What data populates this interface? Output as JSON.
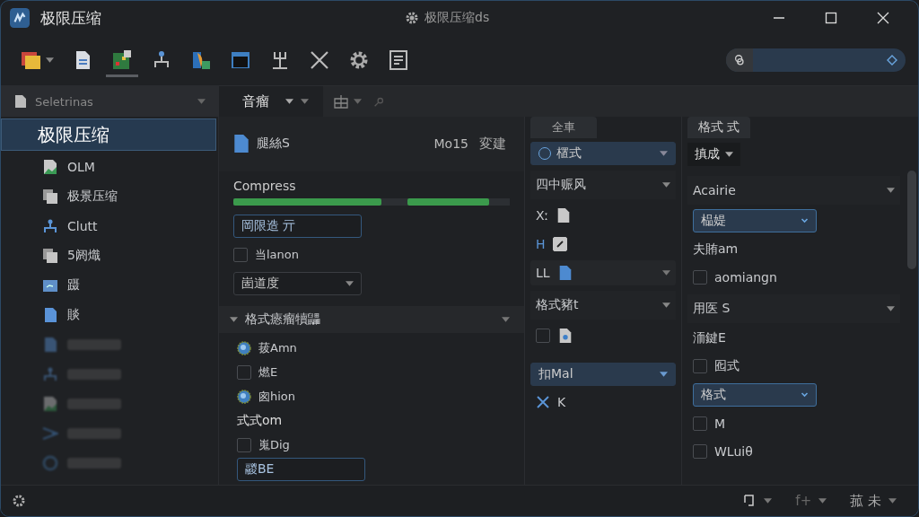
{
  "window": {
    "title": "极限压缩",
    "center_title": "极限压缩ds"
  },
  "toolbar": {
    "tools": [
      {
        "kind": "folder",
        "selected": false
      },
      {
        "kind": "doc",
        "selected": false
      },
      {
        "kind": "grid",
        "selected": true
      },
      {
        "kind": "network",
        "selected": false
      },
      {
        "kind": "box",
        "selected": false
      },
      {
        "kind": "monitor",
        "selected": false
      },
      {
        "kind": "fork",
        "selected": false
      },
      {
        "kind": "scissors",
        "selected": false
      },
      {
        "kind": "gear",
        "selected": false
      },
      {
        "kind": "list",
        "selected": false
      }
    ]
  },
  "sidebar": {
    "header": "Seletrinas",
    "items": [
      {
        "label": "极限压缩",
        "kind": "plain",
        "selected": true
      },
      {
        "label": "OLM",
        "kind": "image",
        "selected": false
      },
      {
        "label": "极景压缩",
        "kind": "copy",
        "selected": false
      },
      {
        "label": "Clutt",
        "kind": "network",
        "selected": false
      },
      {
        "label": "5阏熾",
        "kind": "copy",
        "selected": false
      },
      {
        "label": "蹑",
        "kind": "folder",
        "selected": false
      },
      {
        "label": "賧",
        "kind": "doc",
        "selected": false
      },
      {
        "kind": "doc",
        "selected": false
      },
      {
        "kind": "network",
        "selected": false
      },
      {
        "kind": "image",
        "selected": false
      },
      {
        "kind": "scissors",
        "selected": false
      },
      {
        "kind": "ring",
        "selected": false
      }
    ]
  },
  "content_tab": {
    "label": "音瘤"
  },
  "panel_main": {
    "file_name": "腿絲S",
    "meta": "Mo15",
    "action": "変建",
    "progress_label": "Compress",
    "progress": [
      {
        "level": 0.85
      },
      {
        "level": 0.8
      }
    ],
    "name_field": {
      "value": "岡限造 亓"
    },
    "option": {
      "label": "当lanon",
      "checked": false
    },
    "select": {
      "value": "崮道度"
    },
    "section": {
      "title": "格式瘱瘤犢鼺",
      "expanded": true,
      "items": [
        {
          "kind": "globe",
          "label": "菝Amn"
        },
        {
          "kind": "checkbox",
          "label": "燃E",
          "checked": false
        },
        {
          "kind": "globe",
          "label": "囪hion"
        },
        {
          "kind": "text",
          "label": "式式om"
        },
        {
          "kind": "checkbox",
          "label": "嵬Dig",
          "checked": false
        },
        {
          "kind": "field",
          "label": "鬷BE"
        }
      ]
    }
  },
  "panel_mid": {
    "tab": "全車",
    "select": {
      "value": "㯰式"
    },
    "groups": [
      {
        "title": "四中赈风",
        "rows": [
          {
            "kind": "file",
            "label": "Xː"
          },
          {
            "kind": "check",
            "label": "H",
            "checked": true
          },
          {
            "kind": "doc",
            "label": "LL"
          }
        ]
      },
      {
        "title": "格式豬t",
        "rows": [
          {
            "kind": "checkfile",
            "checked": false
          }
        ]
      }
    ],
    "select2": {
      "value": "扣Mal"
    },
    "tool": {
      "label": "K"
    }
  },
  "panel_right": {
    "tab": "格式  式",
    "dropdown": "搷成",
    "rows": [
      {
        "kind": "header",
        "label": "Acairie"
      },
      {
        "kind": "select",
        "label": "榀媞"
      },
      {
        "kind": "text",
        "label": "夫賄am"
      },
      {
        "kind": "checkbox",
        "label": "aomiangn",
        "checked": false
      },
      {
        "kind": "header",
        "label": "用医 S"
      },
      {
        "kind": "text",
        "label": "洏鍵E"
      },
      {
        "kind": "checkbox",
        "label": "囮式",
        "checked": false
      },
      {
        "kind": "select",
        "label": "格式"
      },
      {
        "kind": "checkbox",
        "label": "M",
        "checked": false
      },
      {
        "kind": "checkbox",
        "label": "WLuiθ",
        "checked": false
      }
    ]
  },
  "status_bar": {
    "items": [
      {
        "kind": "icon"
      },
      {
        "kind": "text",
        "label": "f+"
      },
      {
        "kind": "text",
        "label": "菰 未"
      }
    ]
  }
}
